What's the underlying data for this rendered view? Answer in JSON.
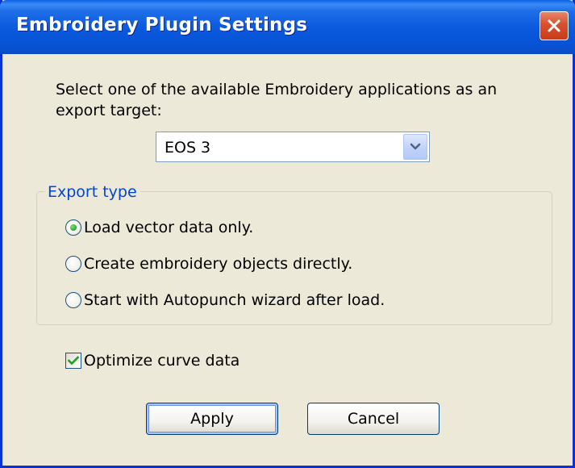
{
  "window": {
    "title": "Embroidery Plugin Settings",
    "close_icon": "close-x-icon"
  },
  "prompt": {
    "text": "Select one of the available Embroidery applications as an export target:"
  },
  "target_select": {
    "value": "EOS 3",
    "icon": "chevron-down-icon"
  },
  "export_type": {
    "legend": "Export type",
    "options": [
      {
        "label": "Load vector data only.",
        "selected": true
      },
      {
        "label": "Create embroidery objects directly.",
        "selected": false
      },
      {
        "label": "Start with Autopunch wizard after load.",
        "selected": false
      }
    ]
  },
  "optimize": {
    "label": "Optimize curve data",
    "checked": true
  },
  "buttons": {
    "apply": "Apply",
    "cancel": "Cancel"
  },
  "colors": {
    "title_bar": "#0a58dd",
    "dialog_bg": "#ece9d8",
    "close_button": "#d6502d",
    "group_legend": "#0046d5",
    "check_green": "#21a121"
  }
}
